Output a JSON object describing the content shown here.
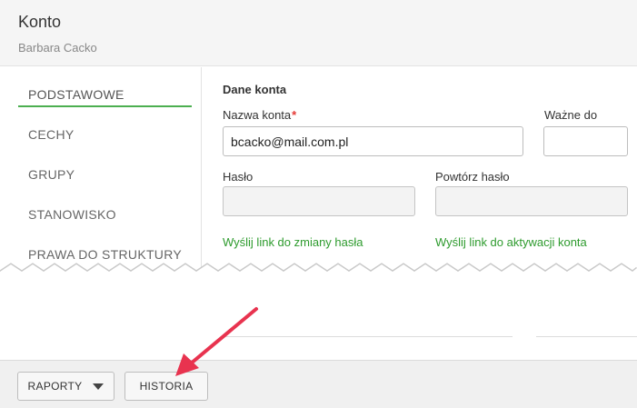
{
  "header": {
    "title": "Konto",
    "subtitle": "Barbara Cacko"
  },
  "sidebar": {
    "items": [
      {
        "label": "PODSTAWOWE",
        "active": true
      },
      {
        "label": "CECHY"
      },
      {
        "label": "GRUPY"
      },
      {
        "label": "STANOWISKO"
      },
      {
        "label": "PRAWA DO STRUKTURY"
      }
    ]
  },
  "account": {
    "section_title": "Dane konta",
    "username_label": "Nazwa konta",
    "required_mark": "*",
    "username_value": "bcacko@mail.com.pl",
    "valid_to_label": "Ważne do",
    "valid_to_value": "",
    "password_label": "Hasło",
    "password_repeat_label": "Powtórz hasło",
    "reset_link": "Wyślij link do zmiany hasła",
    "activation_link": "Wyślij link do aktywacji konta"
  },
  "footer": {
    "reports_label": "RAPORTY",
    "history_label": "HISTORIA"
  },
  "colors": {
    "accent": "#4caf50",
    "link": "#2e9b2e",
    "required": "#e53935",
    "annotation_arrow": "#e8334f"
  }
}
